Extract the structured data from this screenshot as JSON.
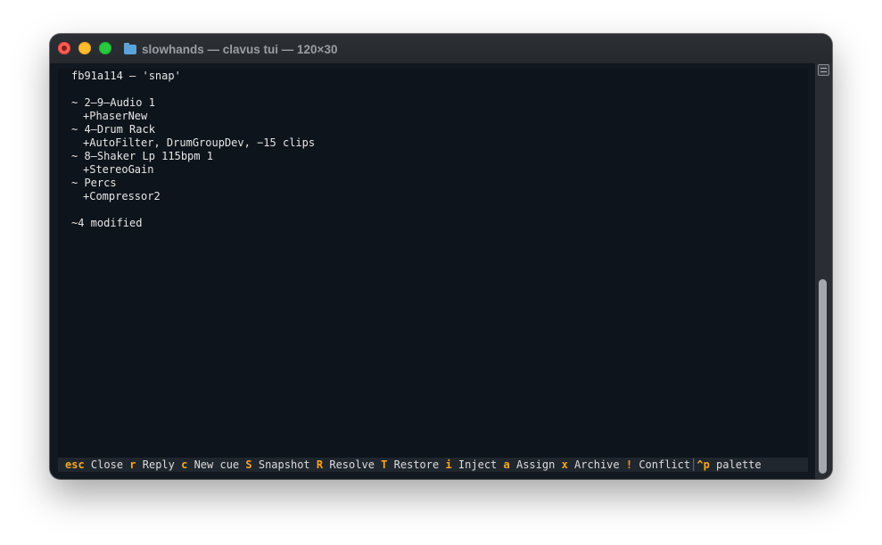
{
  "window": {
    "title": "slowhands — clavus tui — 120×30"
  },
  "terminal": {
    "header": "fb91a114 — 'snap'",
    "tracks": [
      {
        "name": "~ 2–9–Audio 1",
        "detail": "+PhaserNew"
      },
      {
        "name": "~ 4–Drum Rack",
        "detail": "+AutoFilter, DrumGroupDev, −15 clips"
      },
      {
        "name": "~ 8–Shaker Lp 115bpm 1",
        "detail": "+StereoGain"
      },
      {
        "name": "~ Percs",
        "detail": "+Compressor2"
      }
    ],
    "summary": "~4 modified"
  },
  "statusbar": {
    "items": [
      {
        "key": "esc",
        "label": "Close"
      },
      {
        "key": "r",
        "label": "Reply"
      },
      {
        "key": "c",
        "label": "New cue"
      },
      {
        "key": "S",
        "label": "Snapshot"
      },
      {
        "key": "R",
        "label": "Resolve"
      },
      {
        "key": "T",
        "label": "Restore"
      },
      {
        "key": "i",
        "label": "Inject"
      },
      {
        "key": "a",
        "label": "Assign"
      },
      {
        "key": "x",
        "label": "Archive"
      },
      {
        "key": "!",
        "label": "Conflict"
      }
    ],
    "separator": "│",
    "palette": {
      "key": "^p",
      "label": "palette"
    }
  },
  "colors": {
    "accent_key": "#f5a623",
    "terminal_bg": "#0e141b",
    "statusbar_bg": "#1f262e",
    "text": "#e6e6e6"
  },
  "icons": {
    "title": "folder-icon"
  }
}
